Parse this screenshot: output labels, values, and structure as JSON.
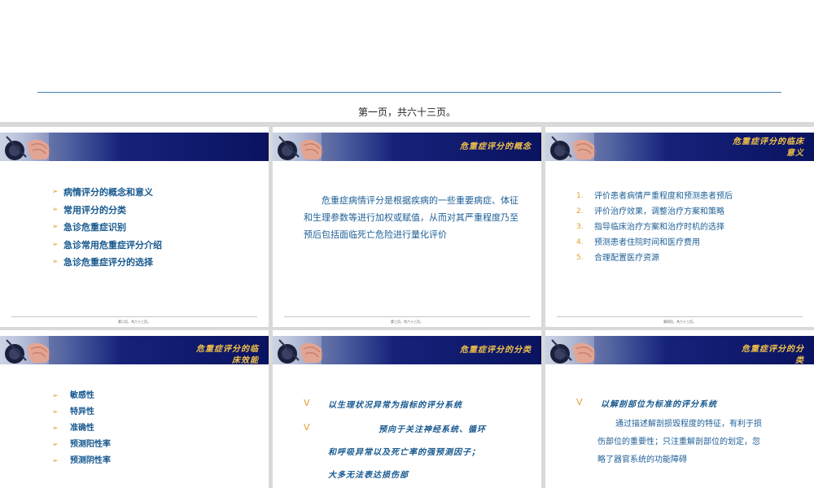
{
  "header": {
    "title": "",
    "page_count": "第一页，共六十三页。"
  },
  "slides": [
    {
      "title": "",
      "items": [
        "病情评分的概念和意义",
        "常用评分的分类",
        "急诊危重症识别",
        "急诊常用危重症评分介绍",
        "急诊危重症评分的选择"
      ],
      "footer": "第二页，共六十三页。"
    },
    {
      "title": "危重症评分的概念",
      "text_lines": [
        "危重症病情评分是根据疾病的一些重要病症、体征",
        "和生理参数等进行加权或赋值，从而对其严重程度乃至",
        "预后包括面临死亡危险进行量化评价"
      ],
      "footer": "第三页，共六十三页。"
    },
    {
      "title": [
        "危重症评分的临床",
        "意义"
      ],
      "items": [
        "评价患者病情严重程度和预测患者预后",
        "评价治疗效果，调整治疗方案和策略",
        "指导临床治疗方案和治疗时机的选择",
        "预测患者住院时间和医疗费用",
        "合理配置医疗资源"
      ],
      "numbers": [
        "1.",
        "2.",
        "3.",
        "4.",
        "5."
      ],
      "footer": "第四页，共六十三页。"
    },
    {
      "title": [
        "危重症评分的临",
        "床效能"
      ],
      "items": [
        "敏感性",
        "特异性",
        "准确性",
        "预测阳性率",
        "预测阴性率"
      ]
    },
    {
      "title": "危重症评分的分类",
      "marker": "V",
      "lines": [
        "以生理状况异常为指标的评分系统",
        "预向于关注神经系统、循环",
        "和呼吸异常以及死亡率的强预测因子；",
        "大多无法表达损伤部"
      ]
    },
    {
      "title": [
        "危重症评分的分",
        "类"
      ],
      "marker": "V",
      "heading": "以解剖部位为标准的评分系统",
      "text_lines": [
        "通过描述解剖损毁程度的特征，有利于损",
        "伤部位的重要性；只注重解剖部位的划定，忽",
        "略了器官系统的功能障碍"
      ]
    }
  ],
  "colors": {
    "banner_dark": "#0a1360",
    "title_gold": "#f2c24a",
    "text_blue": "#17598f",
    "marker_orange": "#e0a030",
    "divider_blue": "#3f7fb0"
  },
  "icons": [
    "banner-photo",
    "bullet-arrow-icon"
  ]
}
